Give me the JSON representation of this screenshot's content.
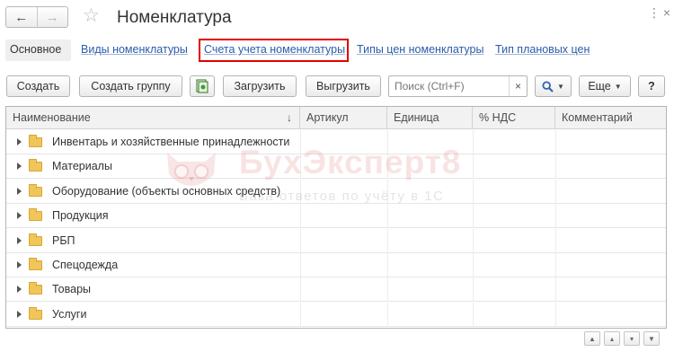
{
  "window": {
    "title": "Номенклатура",
    "menu_icon": "more-icon",
    "close_icon": "close-icon"
  },
  "nav": {
    "back_icon": "arrow-left-icon",
    "forward_icon": "arrow-right-icon",
    "favorite_icon": "star-icon"
  },
  "tabs": [
    {
      "label": "Основное",
      "active": true
    },
    {
      "label": "Виды номенклатуры",
      "active": false
    },
    {
      "label": "Счета учета номенклатуры",
      "active": false,
      "highlighted": true
    },
    {
      "label": "Типы цен номенклатуры",
      "active": false
    },
    {
      "label": "Тип плановых цен",
      "active": false
    }
  ],
  "toolbar": {
    "create": "Создать",
    "create_group": "Создать группу",
    "copy_icon": "copy-icon",
    "load": "Загрузить",
    "unload": "Выгрузить",
    "search_placeholder": "Поиск (Ctrl+F)",
    "search_clear": "×",
    "search_icon": "search-icon",
    "more": "Еще",
    "help": "?"
  },
  "table": {
    "columns": [
      "Наименование",
      "Артикул",
      "Единица",
      "% НДС",
      "Комментарий"
    ],
    "sort_indicator": "↓",
    "rows": [
      "Инвентарь и хозяйственные принадлежности",
      "Материалы",
      "Оборудование (объекты основных средств)",
      "Продукция",
      "РБП",
      "Спецодежда",
      "Товары",
      "Услуги"
    ]
  },
  "watermark": {
    "title": "БухЭксперт8",
    "subtitle": "База ответов по учёту в 1С"
  },
  "colors": {
    "link": "#2a5caa",
    "highlight_border": "#e00000",
    "folder": "#f0c55a"
  }
}
